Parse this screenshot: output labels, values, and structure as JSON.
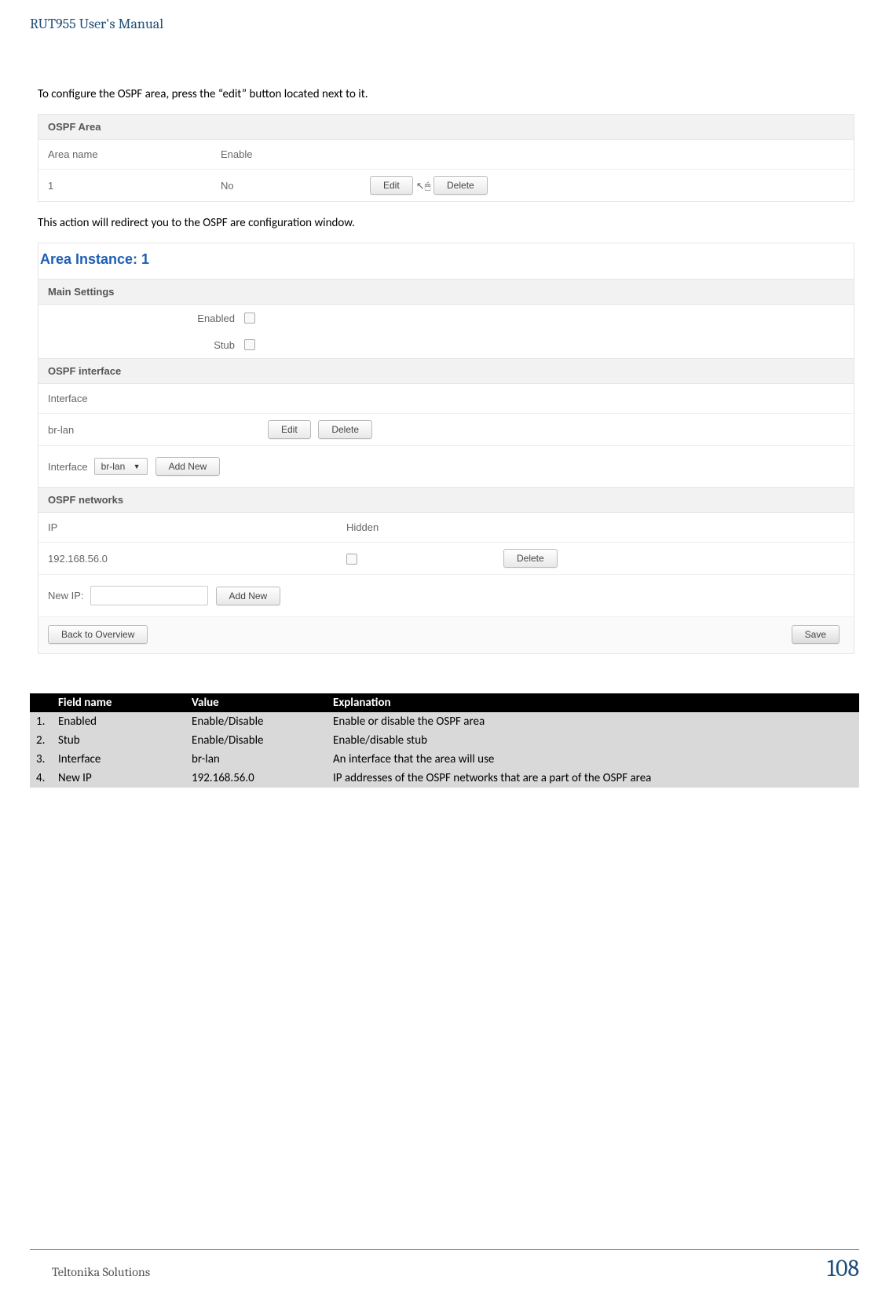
{
  "doc": {
    "title": "RUT955 User's Manual",
    "company": "Teltonika Solutions",
    "page": "108"
  },
  "text": {
    "intro1": "To configure the OSPF area, press the “edit” button located next to it.",
    "intro2": "This action will redirect you to the OSPF are configuration window."
  },
  "ospf_area": {
    "header": "OSPF Area",
    "col_name": "Area name",
    "col_enable": "Enable",
    "row_name": "1",
    "row_enable": "No",
    "edit": "Edit",
    "delete": "Delete"
  },
  "instance": {
    "title": "Area Instance: 1",
    "main_settings": "Main Settings",
    "enabled_label": "Enabled",
    "stub_label": "Stub",
    "ospf_interface": "OSPF interface",
    "iface_header": "Interface",
    "iface_value": "br-lan",
    "edit": "Edit",
    "delete": "Delete",
    "iface_label": "Interface",
    "iface_select": "br-lan",
    "add_new": "Add New",
    "ospf_networks": "OSPF networks",
    "ip_header": "IP",
    "hidden_header": "Hidden",
    "ip_value": "192.168.56.0",
    "new_ip_label": "New IP:",
    "back": "Back to Overview",
    "save": "Save"
  },
  "fields_table": {
    "headers": {
      "name": "Field name",
      "value": "Value",
      "expl": "Explanation"
    },
    "rows": [
      {
        "n": "1.",
        "name": "Enabled",
        "value": "Enable/Disable",
        "expl": "Enable or disable the OSPF area"
      },
      {
        "n": "2.",
        "name": "Stub",
        "value": "Enable/Disable",
        "expl": "Enable/disable stub"
      },
      {
        "n": "3.",
        "name": "Interface",
        "value": "br-lan",
        "expl": "An interface that the area will use"
      },
      {
        "n": "4.",
        "name": "New IP",
        "value": "192.168.56.0",
        "expl": "IP addresses of the OSPF networks that are a part of the OSPF area"
      }
    ]
  }
}
